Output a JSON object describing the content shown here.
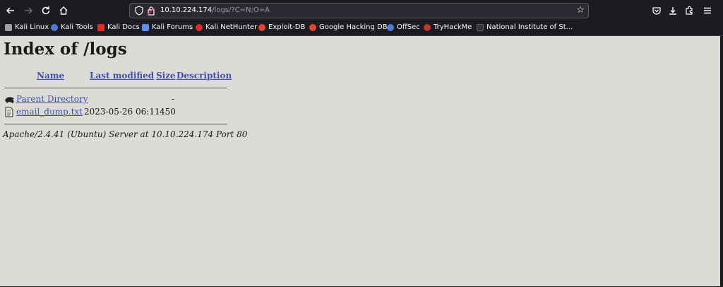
{
  "browser": {
    "url_host": "10.10.224.174",
    "url_path": "/logs/?C=N;O=A"
  },
  "bookmarks": [
    {
      "label": "Kali Linux",
      "icon": "kali-icon",
      "color": "#9aa0a6"
    },
    {
      "label": "Kali Tools",
      "icon": "kali-tools-icon",
      "color": "#4f7bd8"
    },
    {
      "label": "Kali Docs",
      "icon": "kali-docs-icon",
      "color": "#d93025"
    },
    {
      "label": "Kali Forums",
      "icon": "kali-forums-icon",
      "color": "#5b8def"
    },
    {
      "label": "Kali NetHunter",
      "icon": "nethunter-icon",
      "color": "#d93025"
    },
    {
      "label": "Exploit-DB",
      "icon": "exploit-db-icon",
      "color": "#e0452f"
    },
    {
      "label": "Google Hacking DB",
      "icon": "ghdb-icon",
      "color": "#e0452f"
    },
    {
      "label": "OffSec",
      "icon": "offsec-icon",
      "color": "#4f7bd8"
    },
    {
      "label": "TryHackMe",
      "icon": "tryhackme-icon",
      "color": "#c0392b"
    },
    {
      "label": "National Institute of St...",
      "icon": "nist-icon",
      "color": "#333333"
    }
  ],
  "page": {
    "title": "Index of /logs",
    "columns": {
      "name": "Name",
      "last_modified": "Last modified",
      "size": "Size",
      "description": "Description"
    },
    "parent": {
      "name": "Parent Directory",
      "size": "-"
    },
    "file": {
      "name": "email_dump.txt",
      "modified": "2023-05-26 06:11",
      "size": "450"
    },
    "footer": "Apache/2.4.41 (Ubuntu) Server at 10.10.224.174 Port 80"
  }
}
